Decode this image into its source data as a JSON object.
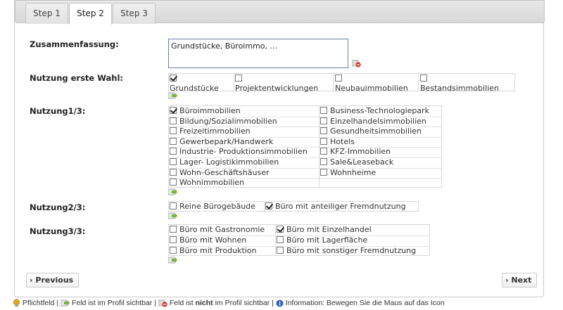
{
  "tabs": [
    {
      "label": "Step 1"
    },
    {
      "label": "Step 2"
    },
    {
      "label": "Step 3"
    }
  ],
  "form": {
    "summary_label": "Zusammenfassung:",
    "summary_value": "Grundstücke, Büroimmo, ...",
    "first_choice_label": "Nutzung erste Wahl:",
    "first_choice_options": [
      {
        "label": "Grundstücke",
        "checked": true
      },
      {
        "label": "Projektentwicklungen",
        "checked": false
      },
      {
        "label": "Neubauimmobilien",
        "checked": false
      },
      {
        "label": "Bestandsimmobilien",
        "checked": false
      }
    ],
    "n1_label": "Nutzung1/3:",
    "n1_options": [
      {
        "label": "Büroimmobilien",
        "checked": true
      },
      {
        "label": "Business-Technologiepark",
        "checked": false
      },
      {
        "label": "Bildung/Sozialimmobilien",
        "checked": false
      },
      {
        "label": "Einzelhandelsimmobilien",
        "checked": false
      },
      {
        "label": "Freizeitimmobilien",
        "checked": false
      },
      {
        "label": "Gesundheitsimmobilien",
        "checked": false
      },
      {
        "label": "Gewerbepark/Handwerk",
        "checked": false
      },
      {
        "label": "Hotels",
        "checked": false
      },
      {
        "label": "Industrie- Produktionsimmobilien",
        "checked": false
      },
      {
        "label": "KFZ-Immobilien",
        "checked": false
      },
      {
        "label": "Lager- Logistikimmobilien",
        "checked": false
      },
      {
        "label": "Sale&Leaseback",
        "checked": false
      },
      {
        "label": "Wohn-Geschäftshäuser",
        "checked": false
      },
      {
        "label": "Wohnheime",
        "checked": false
      },
      {
        "label": "Wohnimmobilien",
        "checked": false
      }
    ],
    "n2_label": "Nutzung2/3:",
    "n2_options": [
      {
        "label": "Reine Bürogebäude",
        "checked": false
      },
      {
        "label": "Büro mit anteiliger Fremdnutzung",
        "checked": true
      }
    ],
    "n3_label": "Nutzung3/3:",
    "n3_options": [
      {
        "label": "Büro mit Gastronomie",
        "checked": false
      },
      {
        "label": "Büro mit Einzelhandel",
        "checked": true
      },
      {
        "label": "Büro mit Wohnen",
        "checked": false
      },
      {
        "label": "Büro mit Lagerfläche",
        "checked": false
      },
      {
        "label": "Büro mit Produktion",
        "checked": false
      },
      {
        "label": "Büro mit sonstiger Fremdnutzung",
        "checked": false
      }
    ]
  },
  "nav": {
    "previous_label": "Previous",
    "next_label": "Next",
    "arrow": "›"
  },
  "legend": {
    "required": "Pflichtfeld |",
    "visible": "Feld ist im Profil sichtbar |",
    "not_visible_pre": "Feld ist",
    "not_visible_bold": "nicht",
    "not_visible_post": "im Profil sichtbar |",
    "info": "Information: Bewegen Sie die Maus auf das Icon"
  },
  "icons": {
    "required": "required-bulb-icon",
    "visible": "visible-arrow-icon",
    "not_visible": "hidden-icon",
    "info": "info-icon"
  },
  "colors": {
    "required": "#e0a72a",
    "visible_green": "#7bb03c",
    "hidden_red": "#d6332c",
    "info_blue": "#2b5fb4"
  }
}
